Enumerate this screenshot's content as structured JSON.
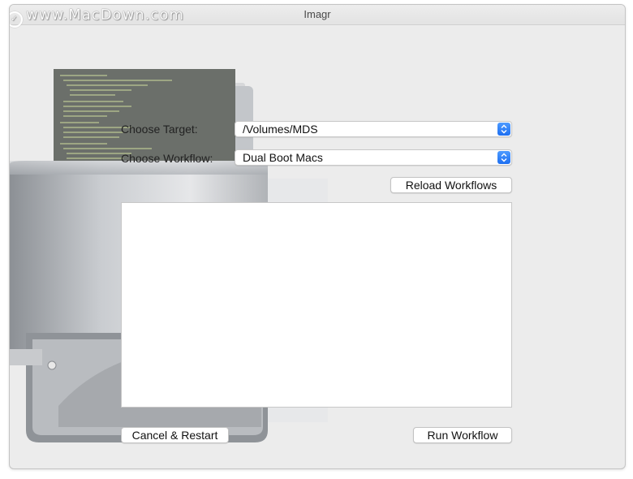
{
  "window": {
    "title": "Imagr"
  },
  "watermark": {
    "text": "www.MacDown.com"
  },
  "form": {
    "target_label": "Choose Target:",
    "target_value": "/Volumes/MDS",
    "workflow_label": "Choose Workflow:",
    "workflow_value": "Dual Boot Macs"
  },
  "buttons": {
    "reload": "Reload Workflows",
    "cancel": "Cancel & Restart",
    "run": "Run Workflow"
  },
  "log": {
    "text": ""
  },
  "colors": {
    "accent": "#1d6ff1",
    "window_bg": "#ececec"
  }
}
